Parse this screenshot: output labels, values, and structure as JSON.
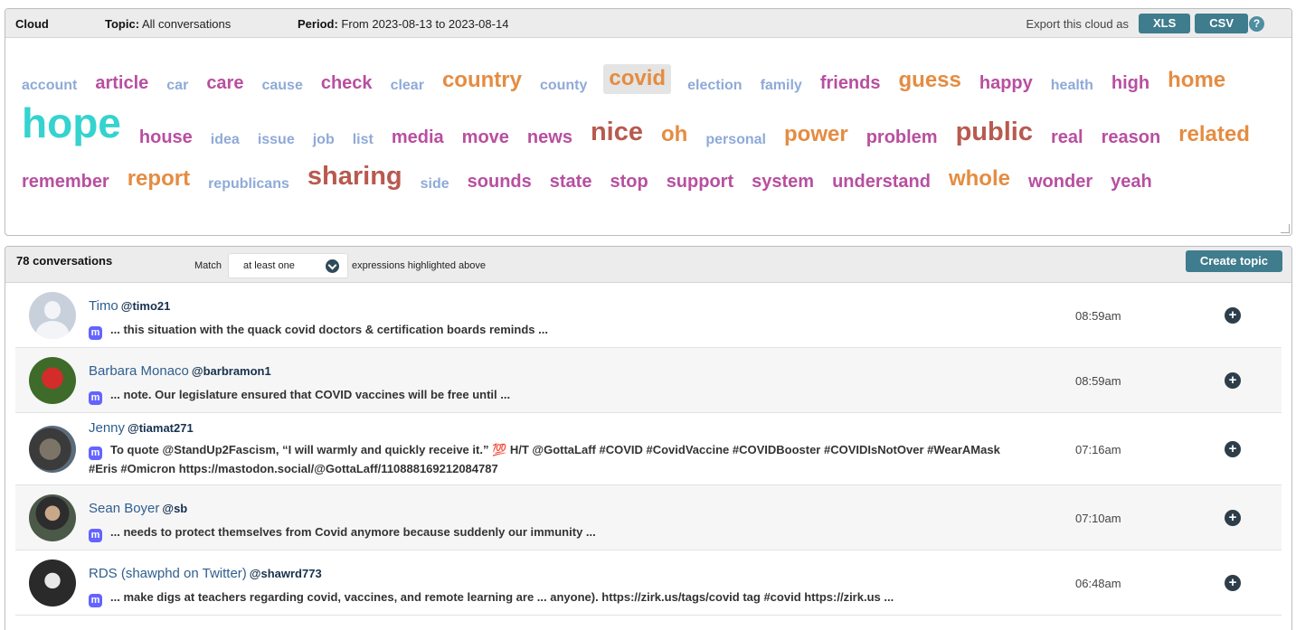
{
  "cloud": {
    "label": "Cloud",
    "topic_label": "Topic:",
    "topic_value": "All conversations",
    "period_label": "Period:",
    "period_value": "From 2023-08-13 to 2023-08-14",
    "export_label": "Export this cloud as",
    "export_xls": "XLS",
    "export_csv": "CSV",
    "help_icon": "?",
    "colors": {
      "small": "#8faad8",
      "medium": "#b84fa0",
      "large": "#e58c41",
      "xlarge": "#b85a4f",
      "top": "#35d3cf"
    },
    "rows": [
      [
        {
          "w": "account",
          "s": 1
        },
        {
          "w": "article",
          "s": 2
        },
        {
          "w": "car",
          "s": 1
        },
        {
          "w": "care",
          "s": 2
        },
        {
          "w": "cause",
          "s": 1
        },
        {
          "w": "check",
          "s": 2
        },
        {
          "w": "clear",
          "s": 1
        },
        {
          "w": "country",
          "s": 3
        },
        {
          "w": "county",
          "s": 1
        },
        {
          "w": "covid",
          "s": 3,
          "selected": true
        },
        {
          "w": "election",
          "s": 1
        },
        {
          "w": "family",
          "s": 1
        },
        {
          "w": "friends",
          "s": 2
        },
        {
          "w": "guess",
          "s": 3
        },
        {
          "w": "happy",
          "s": 2
        },
        {
          "w": "health",
          "s": 1
        },
        {
          "w": "high",
          "s": 2
        },
        {
          "w": "home",
          "s": 3
        }
      ],
      [
        {
          "w": "hope",
          "s": 5
        },
        {
          "w": "house",
          "s": 2
        },
        {
          "w": "idea",
          "s": 1
        },
        {
          "w": "issue",
          "s": 1
        },
        {
          "w": "job",
          "s": 1
        },
        {
          "w": "list",
          "s": 1
        },
        {
          "w": "media",
          "s": 2
        },
        {
          "w": "move",
          "s": 2
        },
        {
          "w": "news",
          "s": 2
        },
        {
          "w": "nice",
          "s": 4
        },
        {
          "w": "oh",
          "s": 3
        },
        {
          "w": "personal",
          "s": 1
        },
        {
          "w": "power",
          "s": 3
        },
        {
          "w": "problem",
          "s": 2
        },
        {
          "w": "public",
          "s": 4
        },
        {
          "w": "real",
          "s": 2
        },
        {
          "w": "reason",
          "s": 2
        },
        {
          "w": "related",
          "s": 3
        }
      ],
      [
        {
          "w": "remember",
          "s": 2
        },
        {
          "w": "report",
          "s": 3
        },
        {
          "w": "republicans",
          "s": 1
        },
        {
          "w": "sharing",
          "s": 4
        },
        {
          "w": "side",
          "s": 1
        },
        {
          "w": "sounds",
          "s": 2
        },
        {
          "w": "state",
          "s": 2
        },
        {
          "w": "stop",
          "s": 2
        },
        {
          "w": "support",
          "s": 2
        },
        {
          "w": "system",
          "s": 2
        },
        {
          "w": "understand",
          "s": 2
        },
        {
          "w": "whole",
          "s": 3
        },
        {
          "w": "wonder",
          "s": 2
        },
        {
          "w": "yeah",
          "s": 2
        }
      ]
    ]
  },
  "conversations": {
    "count_label": "78 conversations",
    "match_label": "Match",
    "match_value": "at least one",
    "match_after": "expressions highlighted above",
    "create_topic": "Create topic",
    "platform_icon": "m",
    "add_icon": "+",
    "items": [
      {
        "name": "Timo",
        "handle": "@timo21",
        "text": "... this situation with the quack covid doctors & certification boards reminds ...",
        "time": "08:59am",
        "avatar": "default-avatar"
      },
      {
        "name": "Barbara Monaco",
        "handle": "@barbramon1",
        "text": "... note. Our legislature ensured that COVID vaccines will be free until ...",
        "time": "08:59am",
        "avatar": "cardinal-bird-avatar"
      },
      {
        "name": "Jenny",
        "handle": "@tiamat271",
        "text": "To quote @StandUp2Fascism, “I will warmly and quickly receive it.” 💯 H/T @GottaLaff #COVID #CovidVaccine #COVIDBooster #COVIDIsNotOver #WearAMask #Eris #Omicron https://mastodon.social/@GottaLaff/110888169212084787",
        "time": "07:16am",
        "avatar": "cat-avatar"
      },
      {
        "name": "Sean Boyer",
        "handle": "@sb",
        "text": "... needs to protect themselves from Covid anymore because suddenly our immunity ...",
        "time": "07:10am",
        "avatar": "man-avatar"
      },
      {
        "name": "RDS (shawphd on Twitter)",
        "handle": "@shawrd773",
        "text": "... make digs at teachers regarding covid, vaccines, and remote learning are ... anyone). https://zirk.us/tags/covid tag #covid https://zirk.us ...",
        "time": "06:48am",
        "avatar": "bw-photo-avatar"
      }
    ]
  }
}
